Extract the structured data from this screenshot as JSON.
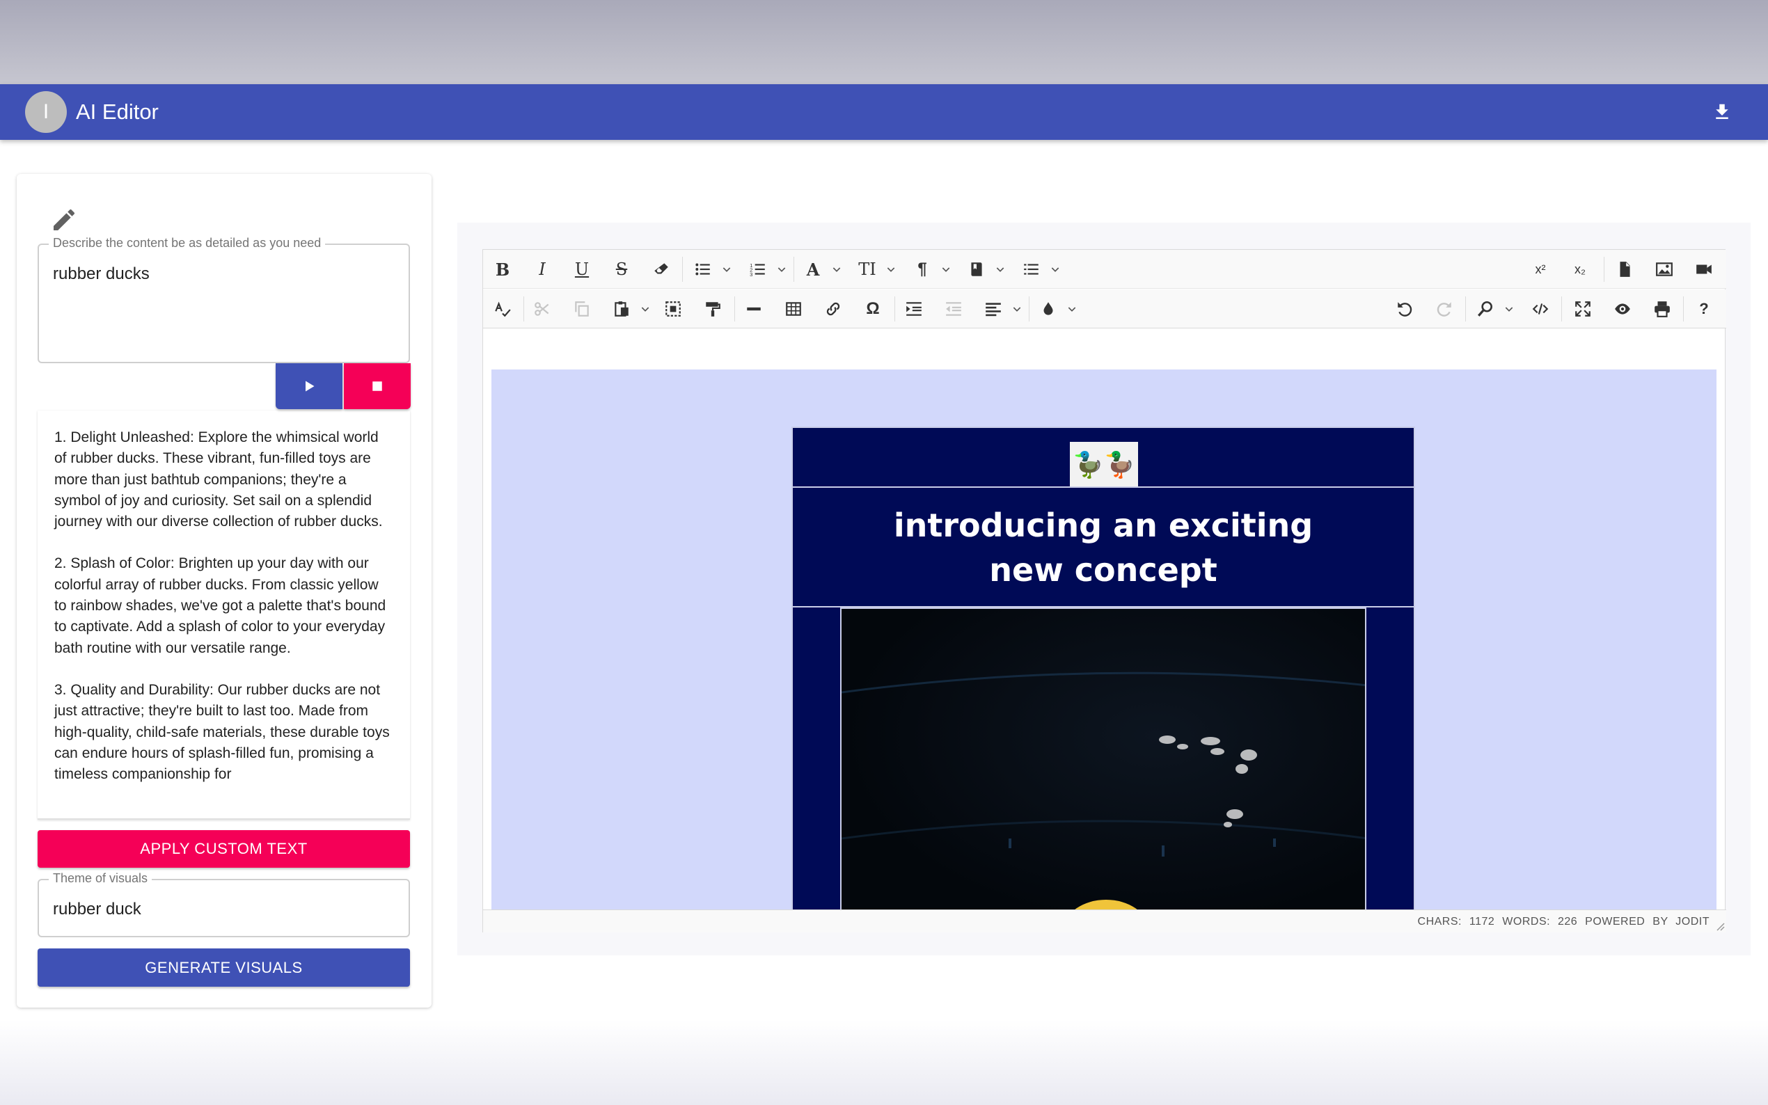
{
  "app": {
    "avatar_letter": "I",
    "title": "AI Editor"
  },
  "left_panel": {
    "prompt_label": "Describe the content be as detailed as you need",
    "prompt_value": "rubber ducks",
    "output_paragraphs": [
      "1. Delight Unleashed: Explore the whimsical world of rubber ducks. These vibrant, fun-filled toys are more than just bathtub companions; they're a symbol of joy and curiosity. Set sail on a splendid journey with our diverse collection of rubber ducks.",
      "2. Splash of Color: Brighten up your day with our colorful array of rubber ducks. From classic yellow to rainbow shades, we've got a palette that's bound to captivate. Add a splash of color to your everyday bath routine with our versatile range.",
      "3. Quality and Durability: Our rubber ducks are not just attractive; they're built to last too. Made from high-quality, child-safe materials, these durable toys can endure hours of splash-filled fun, promising a timeless companionship for"
    ],
    "apply_label": "APPLY CUSTOM TEXT",
    "theme_label": "Theme of visuals",
    "theme_value": "rubber duck",
    "generate_label": "GENERATE VISUALS"
  },
  "editor": {
    "toolbar_row1": {
      "bold": "B",
      "italic": "I",
      "underline": "U",
      "strike": "S",
      "font": "A",
      "font_size": "TI",
      "paragraph": "¶",
      "superscript": "x²",
      "subscript": "x₂"
    },
    "toolbar_row2": {
      "symbol": "Ω",
      "help": "?"
    },
    "content": {
      "logo": "🦆",
      "title_line1": "introducing an exciting",
      "title_line2": "new concept"
    },
    "status": {
      "chars": "CHARS: 1172",
      "words": "WORDS: 226",
      "powered": "POWERED BY JODIT"
    }
  },
  "colors": {
    "primary": "#3f51b5",
    "accent": "#f50057",
    "email_bg": "#000a56",
    "canvas_bg": "#d2d8fb"
  }
}
